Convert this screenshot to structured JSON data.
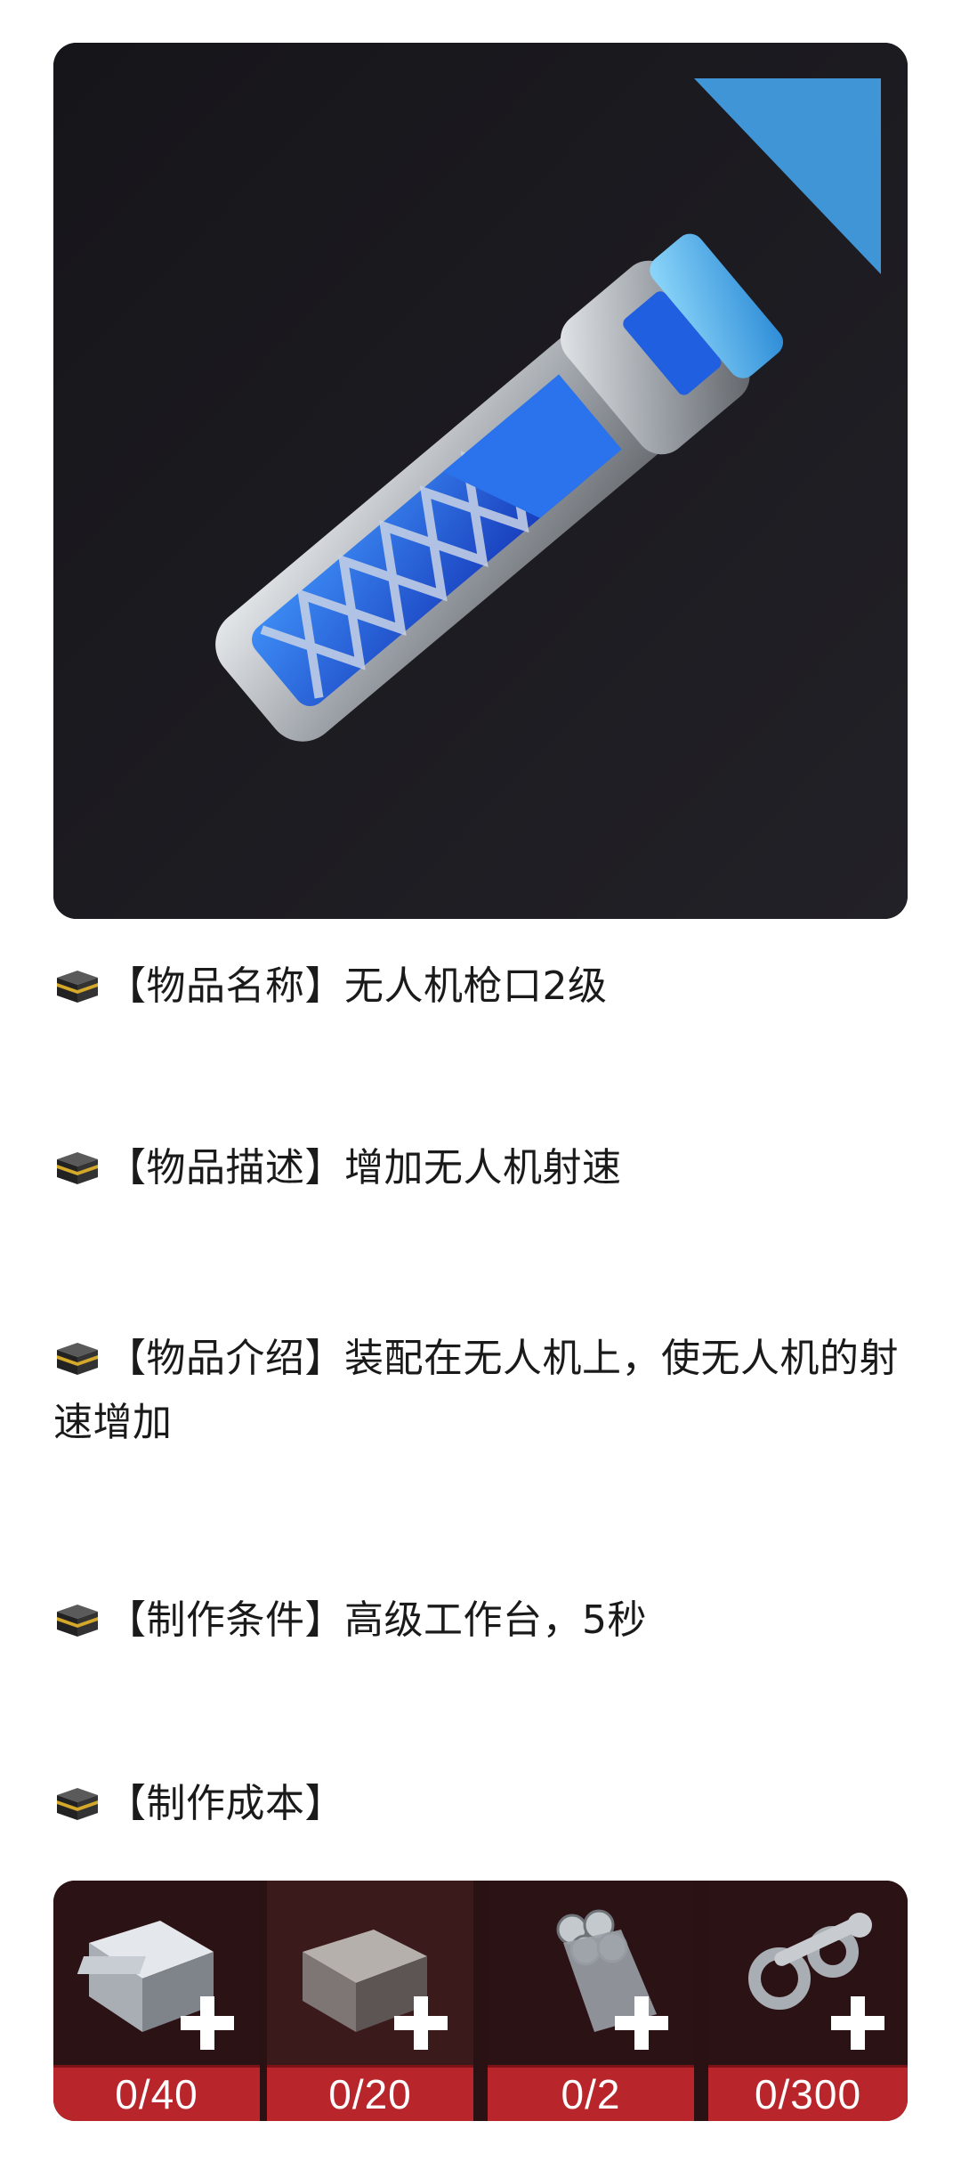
{
  "item_image": {
    "alt_icon": "drone-muzzle-icon",
    "colors": {
      "background": "#1b1a1f",
      "blue": "#1f5fe0",
      "light_blue": "#58b7f2",
      "metal": "#b9bec4"
    }
  },
  "info_lines": [
    {
      "icon": "kaaba-emoji-icon",
      "text": "【物品名称】无人机枪口2级"
    },
    {
      "icon": "kaaba-emoji-icon",
      "text": "【物品描述】增加无人机射速"
    },
    {
      "icon": "kaaba-emoji-icon",
      "text": "【物品介绍】装配在无人机上，使无人机的射速增加"
    },
    {
      "icon": "kaaba-emoji-icon",
      "text": "【制作条件】高级工作台，5秒"
    },
    {
      "icon": "kaaba-emoji-icon",
      "text": "【制作成本】"
    }
  ],
  "cost": {
    "colors": {
      "panel": "#2a1214",
      "count_bar": "#b8262b"
    },
    "items": [
      {
        "icon": "metal-box-icon",
        "count": "0/40"
      },
      {
        "icon": "steel-block-icon",
        "count": "0/20"
      },
      {
        "icon": "steel-pipes-icon",
        "count": "0/2"
      },
      {
        "icon": "gears-and-wrench-icon",
        "count": "0/300"
      }
    ]
  }
}
